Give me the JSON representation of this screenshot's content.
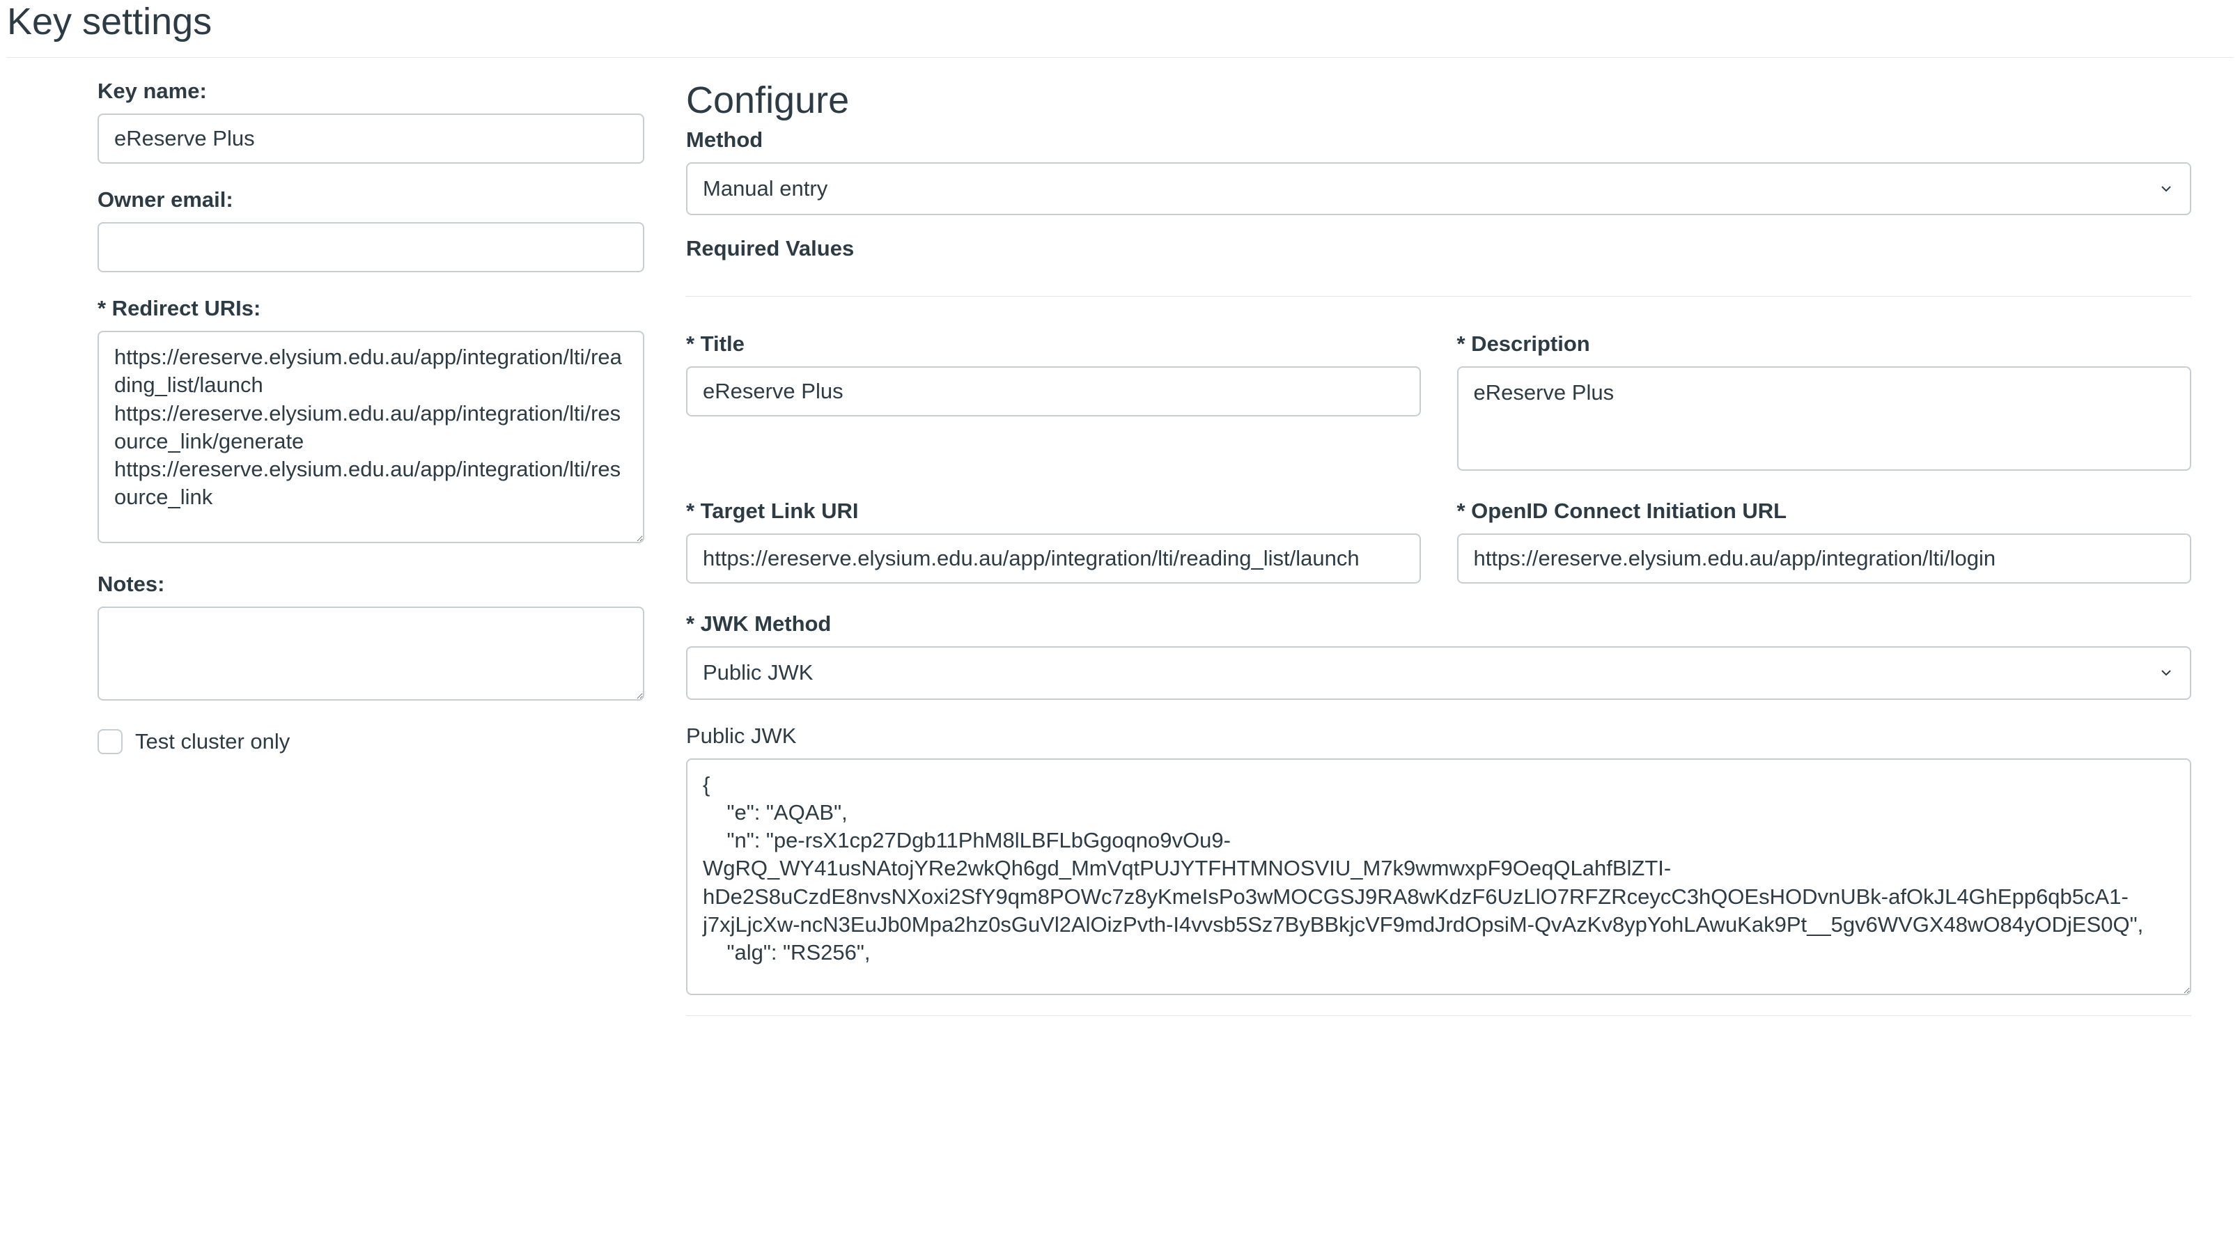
{
  "pageTitle": "Key settings",
  "left": {
    "keyName": {
      "label": "Key name:",
      "value": "eReserve Plus"
    },
    "ownerEmail": {
      "label": "Owner email:",
      "value": ""
    },
    "redirectUris": {
      "label": "* Redirect URIs:",
      "value": "https://ereserve.elysium.edu.au/app/integration/lti/reading_list/launch\nhttps://ereserve.elysium.edu.au/app/integration/lti/resource_link/generate\nhttps://ereserve.elysium.edu.au/app/integration/lti/resource_link"
    },
    "notes": {
      "label": "Notes:",
      "value": ""
    },
    "testCluster": {
      "label": "Test cluster only",
      "checked": false
    }
  },
  "right": {
    "sectionTitle": "Configure",
    "method": {
      "label": "Method",
      "value": "Manual entry"
    },
    "requiredValuesLabel": "Required Values",
    "title": {
      "label": "* Title",
      "value": "eReserve Plus"
    },
    "description": {
      "label": "* Description",
      "value": "eReserve Plus"
    },
    "targetLinkUri": {
      "label": "* Target Link URI",
      "value": "https://ereserve.elysium.edu.au/app/integration/lti/reading_list/launch"
    },
    "openidInitUrl": {
      "label": "* OpenID Connect Initiation URL",
      "value": "https://ereserve.elysium.edu.au/app/integration/lti/login"
    },
    "jwkMethod": {
      "label": "* JWK Method",
      "value": "Public JWK"
    },
    "publicJwk": {
      "label": "Public JWK",
      "value": "{\n    \"e\": \"AQAB\",\n    \"n\": \"pe-rsX1cp27Dgb11PhM8lLBFLbGgoqno9vOu9-WgRQ_WY41usNAtojYRe2wkQh6gd_MmVqtPUJYTFHTMNOSVIU_M7k9wmwxpF9OeqQLahfBlZTI-hDe2S8uCzdE8nvsNXoxi2SfY9qm8POWc7z8yKmeIsPo3wMOCGSJ9RA8wKdzF6UzLlO7RFZRceycC3hQOEsHODvnUBk-afOkJL4GhEpp6qb5cA1-j7xjLjcXw-ncN3EuJb0Mpa2hz0sGuVl2AlOizPvth-I4vvsb5Sz7ByBBkjcVF9mdJrdOpsiM-QvAzKv8ypYohLAwuKak9Pt__5gv6WVGX48wO84yODjES0Q\",\n    \"alg\": \"RS256\","
    }
  }
}
